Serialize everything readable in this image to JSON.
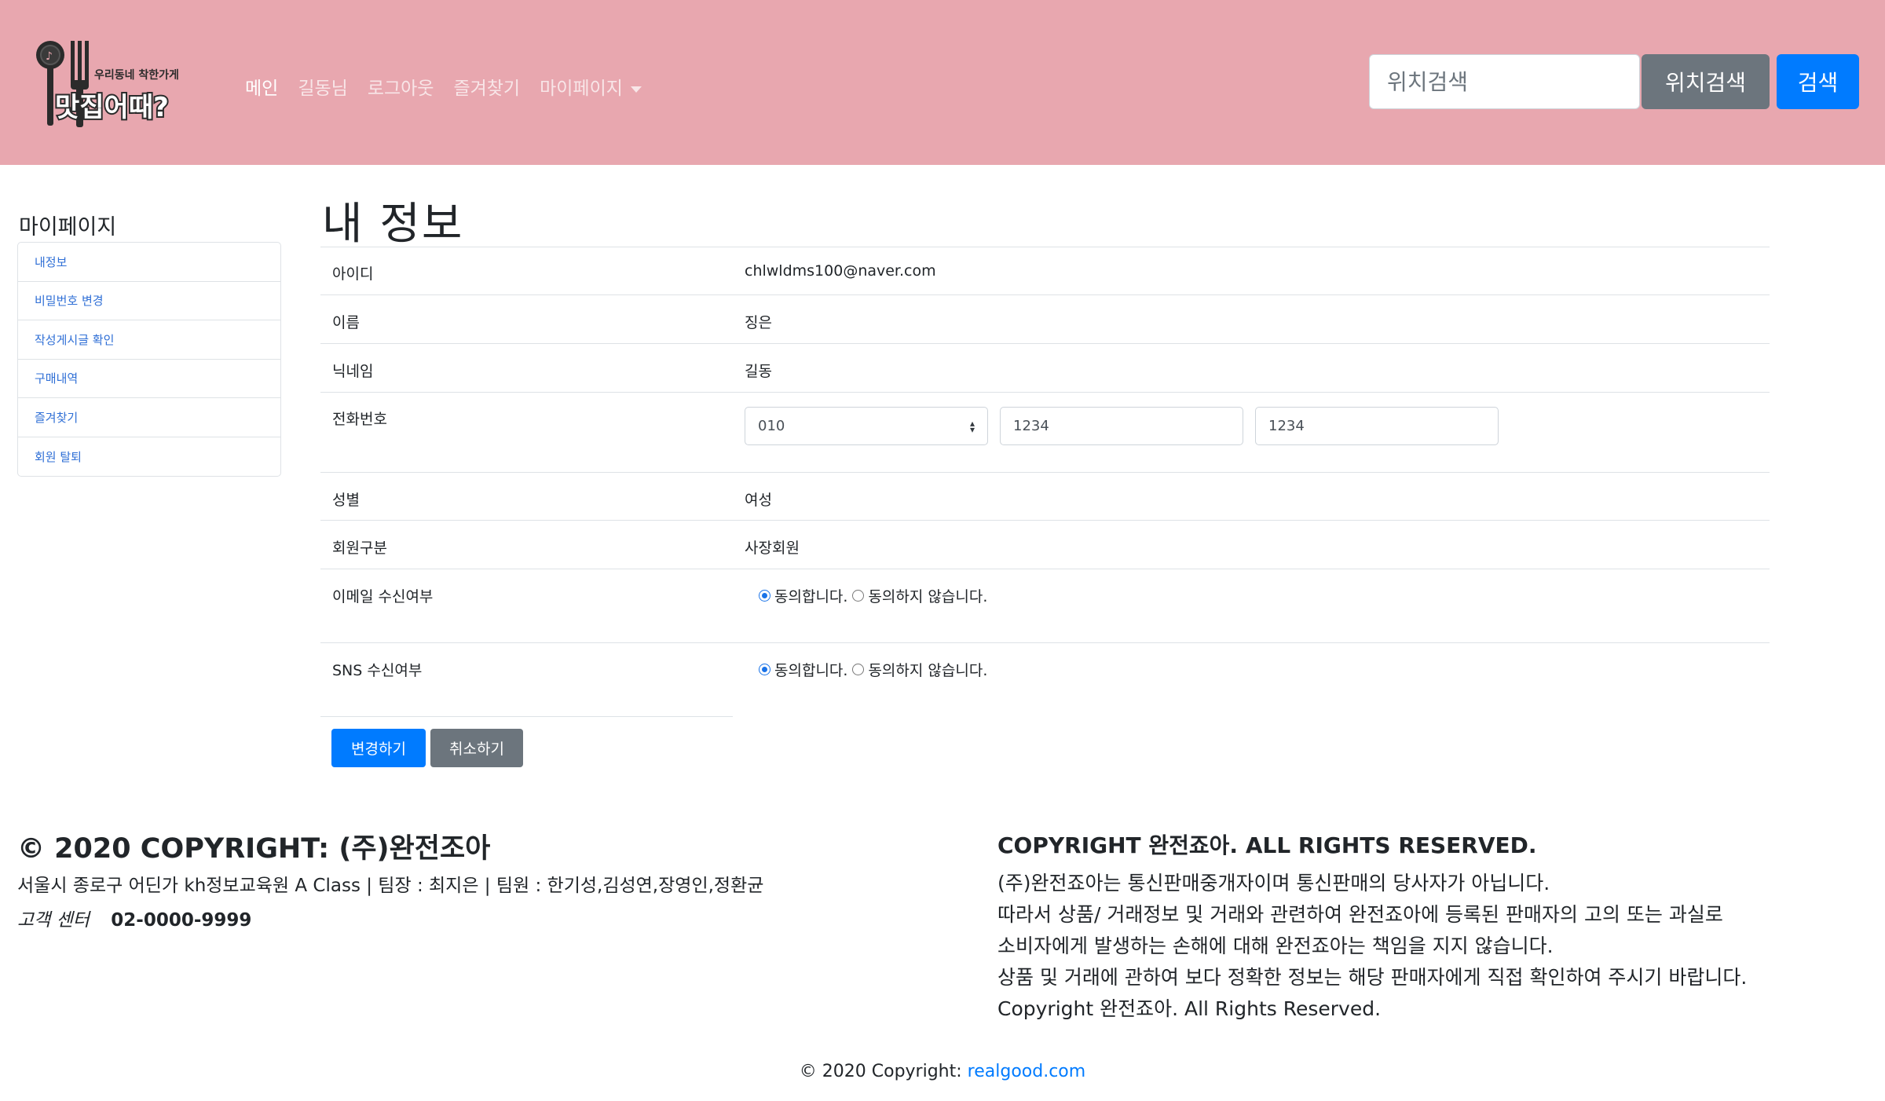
{
  "brand": {
    "logo_text": "맛집어때?",
    "logo_subtext": "우리동네 착한가게"
  },
  "nav": {
    "items": [
      {
        "label": "메인"
      },
      {
        "label": "길동님"
      },
      {
        "label": "로그아웃"
      },
      {
        "label": "즐겨찾기"
      },
      {
        "label": "마이페이지"
      }
    ]
  },
  "search": {
    "placeholder": "위치검색",
    "location_button": "위치검색",
    "search_button": "검색"
  },
  "sidebar": {
    "title": "마이페이지",
    "items": [
      {
        "label": "내정보"
      },
      {
        "label": "비밀번호 변경"
      },
      {
        "label": "작성게시글 확인"
      },
      {
        "label": "구매내역"
      },
      {
        "label": "즐겨찾기"
      },
      {
        "label": "회원 탈퇴"
      }
    ]
  },
  "main": {
    "title": "내 정보",
    "fields": {
      "id": {
        "label": "아이디",
        "value": "chlwldms100@naver.com"
      },
      "name": {
        "label": "이름",
        "value": "징은"
      },
      "nickname": {
        "label": "닉네임",
        "value": "길동"
      },
      "phone": {
        "label": "전화번호",
        "prefix": "010",
        "middle": "1234",
        "last": "1234"
      },
      "gender": {
        "label": "성별",
        "value": "여성"
      },
      "member_type": {
        "label": "회원구분",
        "value": "사장회원"
      },
      "email_opt": {
        "label": "이메일 수신여부",
        "agree": "동의합니다.",
        "disagree": "동의하지 않습니다.",
        "selected": "agree"
      },
      "sns_opt": {
        "label": "SNS 수신여부",
        "agree": "동의합니다.",
        "disagree": "동의하지 않습니다.",
        "selected": "agree"
      }
    },
    "buttons": {
      "change": "변경하기",
      "cancel": "취소하기"
    }
  },
  "footer": {
    "left_title": "© 2020 COPYRIGHT: (주)완전조아",
    "address": "서울시 종로구 어딘가 kh정보교육원 A Class | 팀장 : 최지은 | 팀원 : 한기성,김성연,장영인,정환균",
    "cs_label": "고객 센터",
    "cs_number": "02-0000-9999",
    "right_title": "COPYRIGHT 완전죠아. ALL RIGHTS RESERVED.",
    "right_lines": [
      "(주)완전죠아는 통신판매중개자이며 통신판매의 당사자가 아닙니다.",
      "따라서 상품/ 거래정보 및 거래와 관련하여 완전죠아에 등록된 판매자의 고의 또는 과실로",
      "소비자에게 발생하는 손해에 대해 완전죠아는 책임을 지지 않습니다.",
      "상품 및 거래에 관하여 보다 정확한 정보는 해당 판매자에게 직접 확인하여 주시기 바랍니다.",
      "Copyright 완전죠아. All Rights Reserved."
    ],
    "copyright_prefix": "© 2020 Copyright:",
    "copyright_link": "realgood.com"
  },
  "colors": {
    "navbar_bg": "#e8a7af",
    "primary": "#007bff",
    "secondary": "#6c757d",
    "link": "#2f6fd6"
  }
}
